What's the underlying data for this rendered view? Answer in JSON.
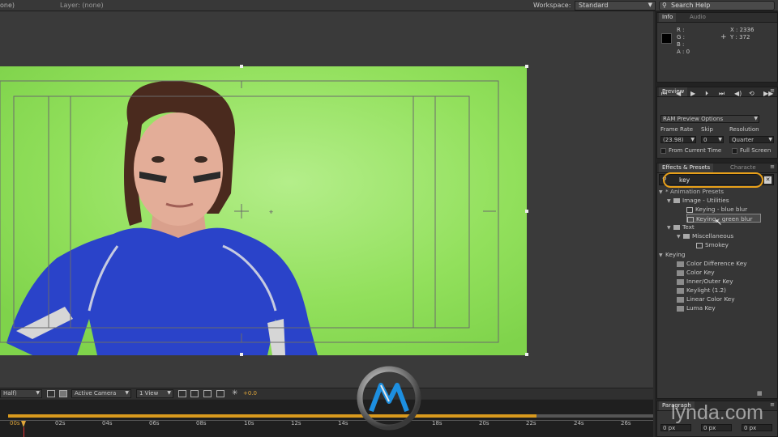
{
  "top_bar": {
    "comp_tab": "one)",
    "layer_tab": "Layer: (none)",
    "workspace_label": "Workspace:",
    "workspace_value": "Standard",
    "search_help": "Search Help"
  },
  "info_panel": {
    "tabs": [
      "Info",
      "Audio"
    ],
    "channels": [
      "R :",
      "G :",
      "B :",
      "A : 0"
    ],
    "x_readout": "X : 2336",
    "y_readout": "Y : 372"
  },
  "preview_panel": {
    "title": "Preview",
    "ram_preview": "RAM Preview Options",
    "frame_rate_label": "Frame Rate",
    "skip_label": "Skip",
    "resolution_label": "Resolution",
    "frame_rate_value": "(23.98)",
    "skip_value": "0",
    "resolution_value": "Quarter",
    "from_current_time": "From Current Time",
    "full_screen": "Full Screen"
  },
  "effects_panel": {
    "tabs": [
      "Effects & Presets",
      "Characte"
    ],
    "search_value": "key",
    "tree": [
      {
        "label": "* Animation Presets",
        "level": 0,
        "type": "group",
        "twirl": "▼"
      },
      {
        "label": "Image - Utilities",
        "level": 1,
        "type": "folder",
        "twirl": "▼"
      },
      {
        "label": "Keying - blue blur",
        "level": 2,
        "type": "preset",
        "twirl": ""
      },
      {
        "label": "Keying - green blur",
        "level": 2,
        "type": "preset",
        "twirl": "",
        "selected": true
      },
      {
        "label": "Text",
        "level": 1,
        "type": "folder",
        "twirl": "▼"
      },
      {
        "label": "Miscellaneous",
        "level": 2,
        "type": "folder",
        "twirl": "▼"
      },
      {
        "label": "Smokey",
        "level": 3,
        "type": "preset",
        "twirl": ""
      },
      {
        "label": "Keying",
        "level": 0,
        "type": "group",
        "twirl": "▼"
      },
      {
        "label": "Color Difference Key",
        "level": 1,
        "type": "effect",
        "twirl": ""
      },
      {
        "label": "Color Key",
        "level": 1,
        "type": "effect",
        "twirl": ""
      },
      {
        "label": "Inner/Outer Key",
        "level": 1,
        "type": "effect",
        "twirl": ""
      },
      {
        "label": "Keylight (1.2)",
        "level": 1,
        "type": "effect",
        "twirl": ""
      },
      {
        "label": "Linear Color Key",
        "level": 1,
        "type": "effect",
        "twirl": ""
      },
      {
        "label": "Luma Key",
        "level": 1,
        "type": "effect",
        "twirl": ""
      }
    ]
  },
  "paragraph_panel": {
    "title": "Paragraph",
    "fields": [
      "0 px",
      "0 px",
      "0 px"
    ]
  },
  "viewer_toolbar": {
    "resolution": "Half)",
    "camera": "Active Camera",
    "view": "1 View",
    "exposure": "+0.0"
  },
  "timeline": {
    "current_tick": "00s",
    "ticks": [
      "02s",
      "04s",
      "06s",
      "08s",
      "10s",
      "12s",
      "14s",
      "18s",
      "20s",
      "22s",
      "24s",
      "26s"
    ]
  },
  "colors": {
    "green_screen": "#8ee05a",
    "shirt_blue": "#2a43c9",
    "search_highlight": "#e8a01a",
    "play_range": "#d99a1e"
  },
  "watermark": "lynda.com"
}
